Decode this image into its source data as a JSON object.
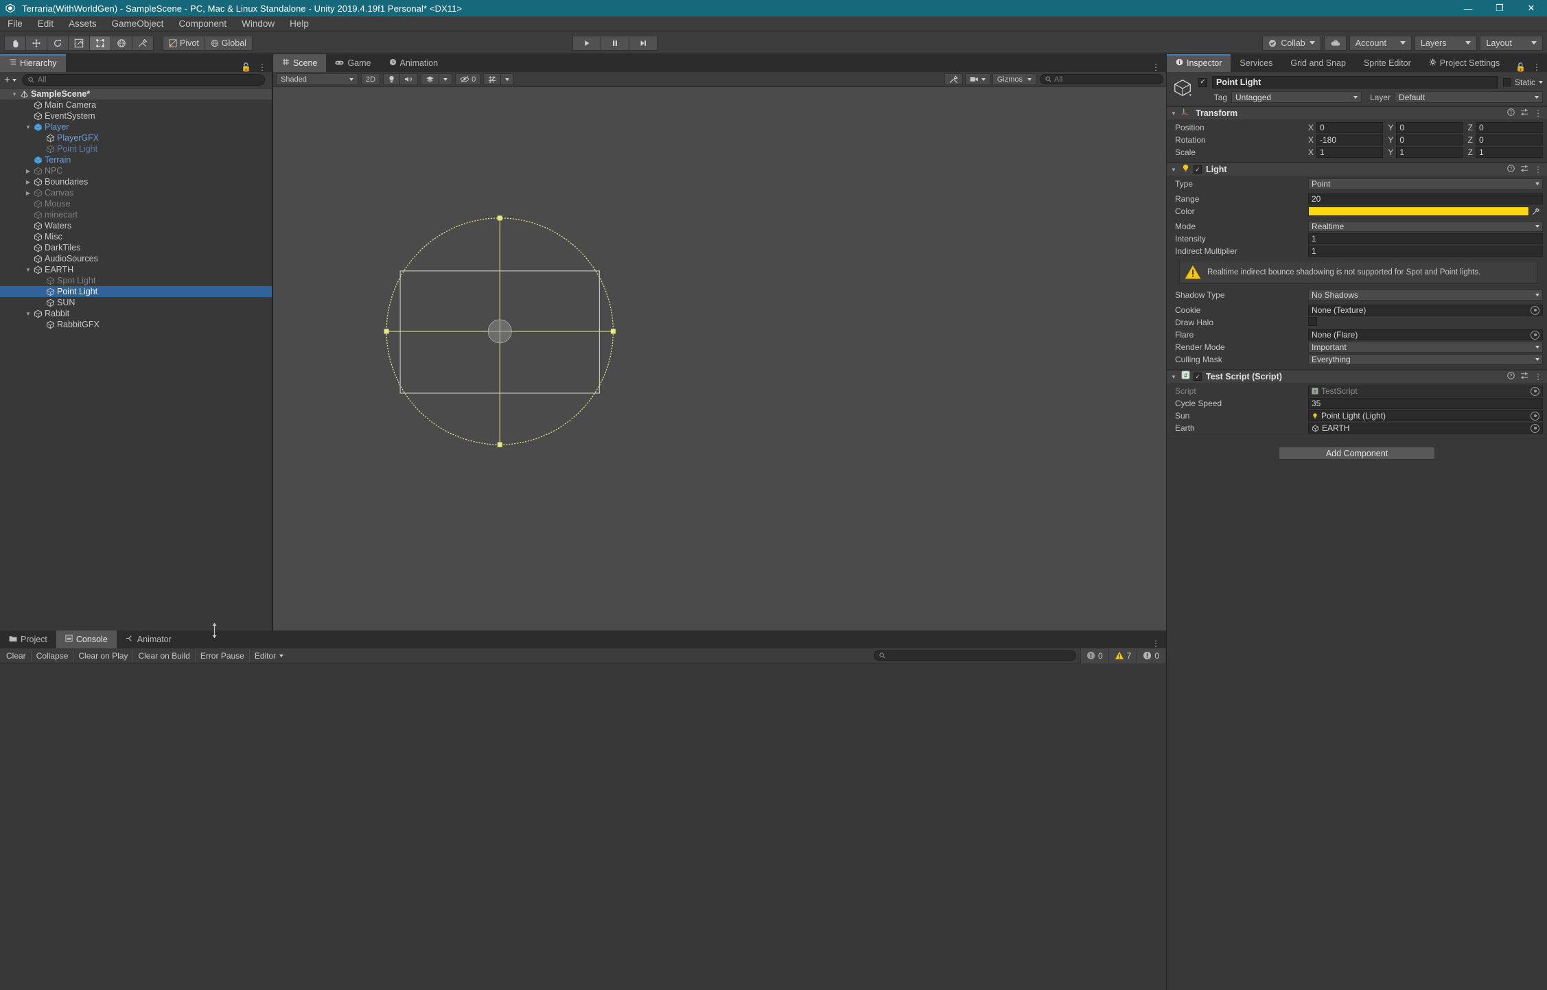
{
  "window": {
    "title": "Terraria(WithWorldGen) - SampleScene - PC, Mac & Linux Standalone - Unity 2019.4.19f1 Personal* <DX11>",
    "minimize": "—",
    "maximize": "❐",
    "close": "✕"
  },
  "menubar": {
    "items": [
      "File",
      "Edit",
      "Assets",
      "GameObject",
      "Component",
      "Window",
      "Help"
    ]
  },
  "toolbar": {
    "tools": [
      {
        "name": "hand-tool",
        "glyph": "✋"
      },
      {
        "name": "move-tool",
        "glyph": "✥"
      },
      {
        "name": "rotate-tool",
        "glyph": "↻"
      },
      {
        "name": "scale-tool",
        "glyph": "⤡"
      },
      {
        "name": "rect-tool",
        "glyph": "⬚"
      },
      {
        "name": "transform-tool",
        "glyph": "⬤"
      },
      {
        "name": "custom-tool",
        "glyph": "⚒"
      }
    ],
    "pivot_label": "Pivot",
    "global_label": "Global",
    "play_label": "▶",
    "pause_label": "‖",
    "step_label": "⏭",
    "collab_label": "Collab",
    "cloud_label": "☁",
    "account_label": "Account",
    "layers_label": "Layers",
    "layout_label": "Layout"
  },
  "hierarchy": {
    "tab_label": "Hierarchy",
    "create_label": "+",
    "search_placeholder": "All",
    "items": [
      {
        "label": "SampleScene*",
        "indent": 0,
        "twisty": "down",
        "icon": "scene-icon",
        "style": "scene"
      },
      {
        "label": "Main Camera",
        "indent": 1,
        "twisty": "",
        "icon": "cube-icon",
        "style": "normal"
      },
      {
        "label": "EventSystem",
        "indent": 1,
        "twisty": "",
        "icon": "cube-icon",
        "style": "normal"
      },
      {
        "label": "Player",
        "indent": 1,
        "twisty": "down",
        "icon": "prefab-icon",
        "style": "blue"
      },
      {
        "label": "PlayerGFX",
        "indent": 2,
        "twisty": "",
        "icon": "cube-icon",
        "style": "blue"
      },
      {
        "label": "Point Light",
        "indent": 2,
        "twisty": "",
        "icon": "cube-dim-icon",
        "style": "bluedim"
      },
      {
        "label": "Terrain",
        "indent": 1,
        "twisty": "",
        "icon": "prefab-icon",
        "style": "blue"
      },
      {
        "label": "NPC",
        "indent": 1,
        "twisty": "right",
        "icon": "cube-dim-icon",
        "style": "dim"
      },
      {
        "label": "Boundaries",
        "indent": 1,
        "twisty": "right",
        "icon": "cube-icon",
        "style": "normal"
      },
      {
        "label": "Canvas",
        "indent": 1,
        "twisty": "right",
        "icon": "cube-dim-icon",
        "style": "dim"
      },
      {
        "label": "Mouse",
        "indent": 1,
        "twisty": "",
        "icon": "cube-dim-icon",
        "style": "dim"
      },
      {
        "label": "minecart",
        "indent": 1,
        "twisty": "",
        "icon": "cube-dim-icon",
        "style": "dim"
      },
      {
        "label": "Waters",
        "indent": 1,
        "twisty": "",
        "icon": "cube-icon",
        "style": "normal"
      },
      {
        "label": "Misc",
        "indent": 1,
        "twisty": "",
        "icon": "cube-icon",
        "style": "normal"
      },
      {
        "label": "DarkTiles",
        "indent": 1,
        "twisty": "",
        "icon": "cube-icon",
        "style": "normal"
      },
      {
        "label": "AudioSources",
        "indent": 1,
        "twisty": "",
        "icon": "cube-icon",
        "style": "normal"
      },
      {
        "label": "EARTH",
        "indent": 1,
        "twisty": "down",
        "icon": "cube-icon",
        "style": "normal"
      },
      {
        "label": "Spot Light",
        "indent": 2,
        "twisty": "",
        "icon": "cube-dim-icon",
        "style": "dim"
      },
      {
        "label": "Point Light",
        "indent": 2,
        "twisty": "",
        "icon": "cube-icon",
        "style": "selected"
      },
      {
        "label": "SUN",
        "indent": 2,
        "twisty": "",
        "icon": "cube-icon",
        "style": "normal"
      },
      {
        "label": "Rabbit",
        "indent": 1,
        "twisty": "down",
        "icon": "cube-icon",
        "style": "normal"
      },
      {
        "label": "RabbitGFX",
        "indent": 2,
        "twisty": "",
        "icon": "cube-icon",
        "style": "normal"
      }
    ]
  },
  "scene": {
    "tabs": [
      {
        "label": "Scene",
        "icon": "grid-icon",
        "active": true
      },
      {
        "label": "Game",
        "icon": "gamepad-icon",
        "active": false
      },
      {
        "label": "Animation",
        "icon": "clock-icon",
        "active": false
      }
    ],
    "shading_mode": "Shaded",
    "mode_2d": "2D",
    "lighting_icon": "●",
    "audio_icon": "♪",
    "fx_icon": "⚙",
    "hidden_count": "0",
    "grid_icon": "#",
    "gizmos_label": "Gizmos",
    "gizmos_search_placeholder": "All"
  },
  "inspector": {
    "tabs": [
      {
        "label": "Inspector",
        "icon": "info-icon",
        "active": true
      },
      {
        "label": "Services",
        "icon": "",
        "active": false
      },
      {
        "label": "Grid and Snap",
        "icon": "",
        "active": false
      },
      {
        "label": "Sprite Editor",
        "icon": "",
        "active": false
      },
      {
        "label": "Project Settings",
        "icon": "gear-icon",
        "active": false
      }
    ],
    "object_name": "Point Light",
    "enabled_check": "✓",
    "static_label": "Static",
    "tag_label": "Tag",
    "tag_value": "Untagged",
    "layer_label": "Layer",
    "layer_value": "Default",
    "transform": {
      "title": "Transform",
      "rows": [
        {
          "name": "Position",
          "x": "0",
          "y": "0",
          "z": "0"
        },
        {
          "name": "Rotation",
          "x": "-180",
          "y": "0",
          "z": "0"
        },
        {
          "name": "Scale",
          "x": "1",
          "y": "1",
          "z": "1"
        }
      ]
    },
    "light": {
      "title": "Light",
      "type_label": "Type",
      "type_value": "Point",
      "range_label": "Range",
      "range_value": "20",
      "color_label": "Color",
      "color_value": "#FFD90F",
      "mode_label": "Mode",
      "mode_value": "Realtime",
      "intensity_label": "Intensity",
      "intensity_value": "1",
      "indirect_label": "Indirect Multiplier",
      "indirect_value": "1",
      "warning_text": "Realtime indirect bounce shadowing is not supported for Spot and Point lights.",
      "shadow_label": "Shadow Type",
      "shadow_value": "No Shadows",
      "cookie_label": "Cookie",
      "cookie_value": "None (Texture)",
      "halo_label": "Draw Halo",
      "flare_label": "Flare",
      "flare_value": "None (Flare)",
      "render_mode_label": "Render Mode",
      "render_mode_value": "Important",
      "culling_label": "Culling Mask",
      "culling_value": "Everything"
    },
    "script": {
      "title": "Test Script (Script)",
      "script_label": "Script",
      "script_value": "TestScript",
      "cycle_label": "Cycle Speed",
      "cycle_value": "35",
      "sun_label": "Sun",
      "sun_value": "Point Light (Light)",
      "earth_label": "Earth",
      "earth_value": "EARTH"
    },
    "add_component_label": "Add Component"
  },
  "console": {
    "tabs": [
      {
        "label": "Project",
        "icon": "folder-icon",
        "active": false
      },
      {
        "label": "Console",
        "icon": "list-icon",
        "active": true
      },
      {
        "label": "Animator",
        "icon": "node-icon",
        "active": false
      }
    ],
    "buttons": [
      "Clear",
      "Collapse",
      "Clear on Play",
      "Clear on Build",
      "Error Pause"
    ],
    "editor_label": "Editor",
    "search_placeholder": "",
    "log_count": "0",
    "warning_count": "7",
    "error_count": "0"
  }
}
